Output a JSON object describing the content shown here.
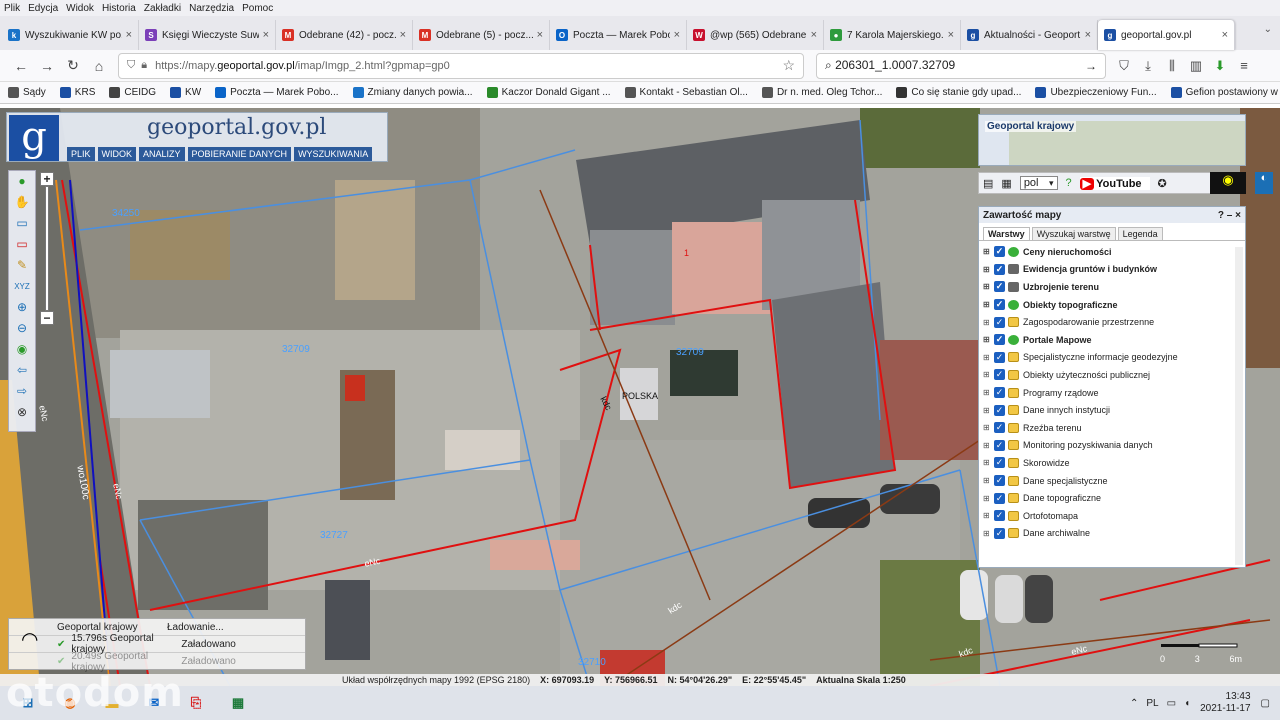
{
  "menubar": [
    "Plik",
    "Edycja",
    "Widok",
    "Historia",
    "Zakładki",
    "Narzędzia",
    "Pomoc"
  ],
  "tabs": [
    {
      "label": "Wyszukiwanie KW po...",
      "color": "#1a73c8",
      "glyph": "k"
    },
    {
      "label": "Księgi Wieczyste Suw...",
      "color": "#7b3fb8",
      "glyph": "S"
    },
    {
      "label": "Odebrane (42) - pocz...",
      "color": "#d93025",
      "glyph": "M"
    },
    {
      "label": "Odebrane (5) - pocz...",
      "color": "#d93025",
      "glyph": "M"
    },
    {
      "label": "Poczta — Marek Pobo...",
      "color": "#0a64c8",
      "glyph": "O"
    },
    {
      "label": "@wp (565) Odebrane",
      "color": "#c8102e",
      "glyph": "W"
    },
    {
      "label": "7 Karola Majerskiego...",
      "color": "#2e9b3d",
      "glyph": "●"
    },
    {
      "label": "Aktualności - Geoport...",
      "color": "#1b4fa3",
      "glyph": "g"
    },
    {
      "label": "geoportal.gov.pl",
      "color": "#1b4fa3",
      "glyph": "g"
    }
  ],
  "nav": {
    "url_prefix": "https://mapy.",
    "url_domain": "geoportal.gov.pl",
    "url_suffix": "/imap/Imgp_2.html?gpmap=gp0",
    "search": "206301_1.0007.32709"
  },
  "bookmarks": [
    {
      "label": "Sądy",
      "color": "#555"
    },
    {
      "label": "KRS",
      "color": "#1b4fa3"
    },
    {
      "label": "CEIDG",
      "color": "#444"
    },
    {
      "label": "KW",
      "color": "#1b4fa3"
    },
    {
      "label": "Poczta — Marek Pobo...",
      "color": "#0a64c8"
    },
    {
      "label": "Zmiany danych powia...",
      "color": "#1a73c8"
    },
    {
      "label": "Kaczor Donald Gigant ...",
      "color": "#2a8a2a"
    },
    {
      "label": "Kontakt - Sebastian Ol...",
      "color": "#555"
    },
    {
      "label": "Dr n. med. Oleg Tchor...",
      "color": "#555"
    },
    {
      "label": "Co się stanie gdy upad...",
      "color": "#333"
    },
    {
      "label": "Ubezpieczeniowy Fun...",
      "color": "#1b4fa3"
    },
    {
      "label": "Gefion postawiony w s...",
      "color": "#1b4fa3"
    }
  ],
  "logo": {
    "title": "geoportal.gov.pl",
    "menu": [
      "PLIK",
      "WIDOK",
      "ANALIZY",
      "POBIERANIE DANYCH",
      "WYSZUKIWANIA"
    ]
  },
  "krajowy": "Geoportal krajowy",
  "lang": "pol",
  "youtube": "YouTube",
  "layers_panel": {
    "title": "Zawartość mapy",
    "tabs": [
      "Warstwy",
      "Wyszukaj warstwę",
      "Legenda"
    ],
    "items": [
      {
        "label": "Ceny nieruchomości",
        "bold": true,
        "icon": "grn"
      },
      {
        "label": "Ewidencja gruntów i budynków",
        "bold": true,
        "icon": "dk"
      },
      {
        "label": "Uzbrojenie terenu",
        "bold": true,
        "icon": "dk"
      },
      {
        "label": "Obiekty topograficzne",
        "bold": true,
        "icon": "grn"
      },
      {
        "label": "Zagospodarowanie przestrzenne",
        "bold": false,
        "icon": "fold"
      },
      {
        "label": "Portale Mapowe",
        "bold": true,
        "icon": "grn"
      },
      {
        "label": "Specjalistyczne informacje geodezyjne",
        "bold": false,
        "icon": "fold"
      },
      {
        "label": "Obiekty użyteczności publicznej",
        "bold": false,
        "icon": "fold"
      },
      {
        "label": "Programy rządowe",
        "bold": false,
        "icon": "fold"
      },
      {
        "label": "Dane innych instytucji",
        "bold": false,
        "icon": "fold"
      },
      {
        "label": "Rzeźba terenu",
        "bold": false,
        "icon": "fold"
      },
      {
        "label": "Monitoring pozyskiwania danych",
        "bold": false,
        "icon": "fold"
      },
      {
        "label": "Skorowidze",
        "bold": false,
        "icon": "fold"
      },
      {
        "label": "Dane specjalistyczne",
        "bold": false,
        "icon": "fold"
      },
      {
        "label": "Dane topograficzne",
        "bold": false,
        "icon": "fold"
      },
      {
        "label": "Ortofotomapa",
        "bold": false,
        "icon": "fold"
      },
      {
        "label": "Dane archiwalne",
        "bold": false,
        "icon": "fold"
      }
    ]
  },
  "map_labels": {
    "parcel1": "32709",
    "parcel2": "32709",
    "parcel3": "32727",
    "parcel4": "32710",
    "parcel5": "34250",
    "country": "POLSKA",
    "kdc1": "kdc",
    "kdc2": "kdc",
    "kdc3": "kdc",
    "wo": "wo100c",
    "eNc1": "eNc",
    "eNc2": "eNc",
    "eNc3": "eNc",
    "eNc4": "eNc",
    "one": "1"
  },
  "status": {
    "rows": [
      {
        "name": "Geoportal krajowy",
        "state": "Ładowanie..."
      },
      {
        "name": "15.796s Geoportal krajowy",
        "state": "Załadowano"
      },
      {
        "name": "20.49s Geoportal krajowy",
        "state": "Załadowano"
      }
    ]
  },
  "scale": {
    "t0": "0",
    "t1": "3",
    "t2": "6m"
  },
  "coords": {
    "system": "Układ współrzędnych mapy 1992 (EPSG 2180)",
    "x": "X: 697093.19",
    "y": "Y: 756966.51",
    "n": "N: 54°04'26.29\"",
    "e": "E: 22°55'45.45\"",
    "scale": "Aktualna Skala 1:250"
  },
  "taskbar": {
    "lang": "PL",
    "time": "13:43",
    "date": "2021-11-17"
  },
  "watermark": "otodom"
}
